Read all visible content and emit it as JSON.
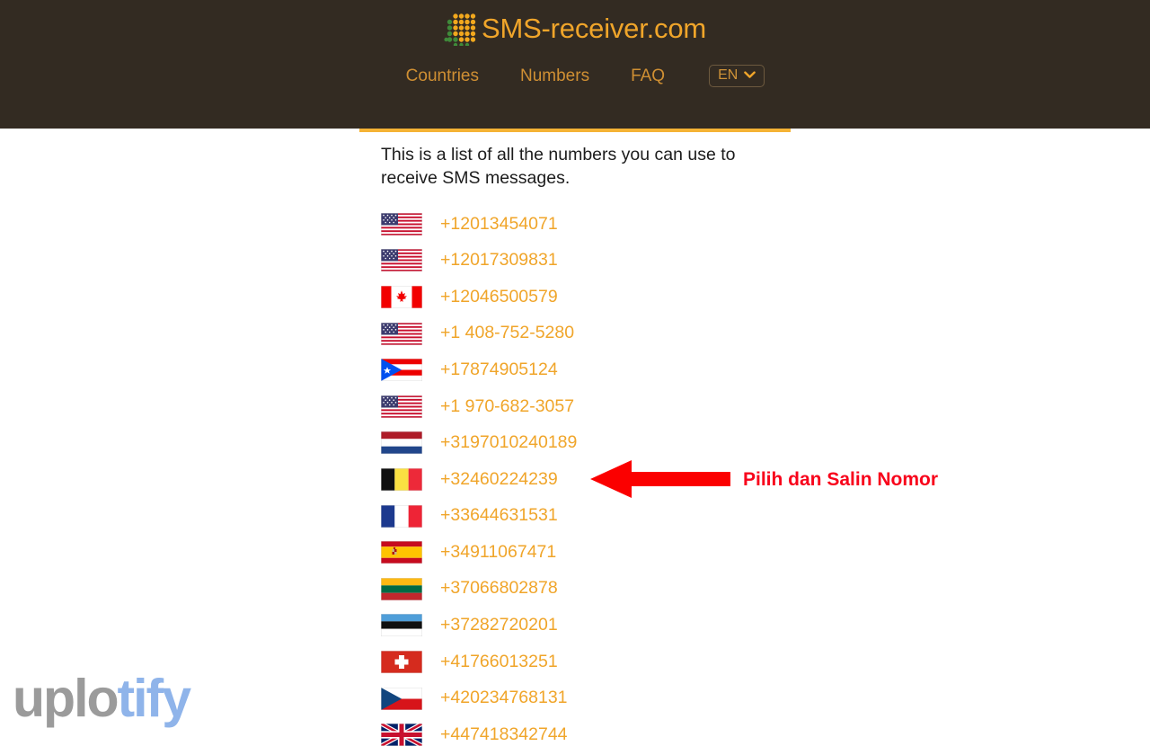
{
  "header": {
    "brand_name": "SMS-receiver.com",
    "brand_logo_icon": "dot-matrix-logo-icon",
    "nav": [
      {
        "label": "Countries",
        "name": "nav-link-countries"
      },
      {
        "label": "Numbers",
        "name": "nav-link-numbers"
      },
      {
        "label": "FAQ",
        "name": "nav-link-faq"
      }
    ],
    "language": {
      "code": "EN",
      "chevron_icon": "chevron-down-icon"
    },
    "background_color": "#332b22",
    "accent_color": "#f0a52a"
  },
  "main": {
    "intro_text": "This is a list of all the numbers you can use to receive SMS messages.",
    "top_border_color": "#f5b335",
    "numbers": [
      {
        "flag": "us",
        "country": "United States",
        "number": "+12013454071"
      },
      {
        "flag": "us",
        "country": "United States",
        "number": "+12017309831"
      },
      {
        "flag": "ca",
        "country": "Canada",
        "number": "+12046500579"
      },
      {
        "flag": "us",
        "country": "United States",
        "number": "+1 408-752-5280"
      },
      {
        "flag": "pr",
        "country": "Puerto Rico",
        "number": "+17874905124"
      },
      {
        "flag": "us",
        "country": "United States",
        "number": "+1 970-682-3057"
      },
      {
        "flag": "nl",
        "country": "Netherlands",
        "number": "+3197010240189"
      },
      {
        "flag": "be",
        "country": "Belgium",
        "number": "+32460224239"
      },
      {
        "flag": "fr",
        "country": "France",
        "number": "+33644631531"
      },
      {
        "flag": "es",
        "country": "Spain",
        "number": "+34911067471"
      },
      {
        "flag": "lt",
        "country": "Lithuania",
        "number": "+37066802878"
      },
      {
        "flag": "ee",
        "country": "Estonia",
        "number": "+37282720201"
      },
      {
        "flag": "ch",
        "country": "Switzerland",
        "number": "+41766013251"
      },
      {
        "flag": "cz",
        "country": "Czech Republic",
        "number": "+420234768131"
      },
      {
        "flag": "gb",
        "country": "United Kingdom",
        "number": "+447418342744"
      }
    ],
    "number_color": "#f0a52a"
  },
  "annotation": {
    "text": "Pilih dan Salin Nomor",
    "arrow_icon": "left-arrow-icon",
    "color": "#f8031b"
  },
  "watermark": {
    "part_one": "uplo",
    "part_two": "tify",
    "part_one_color": "#9b9b9b",
    "part_two_color": "#8fb4ea"
  }
}
